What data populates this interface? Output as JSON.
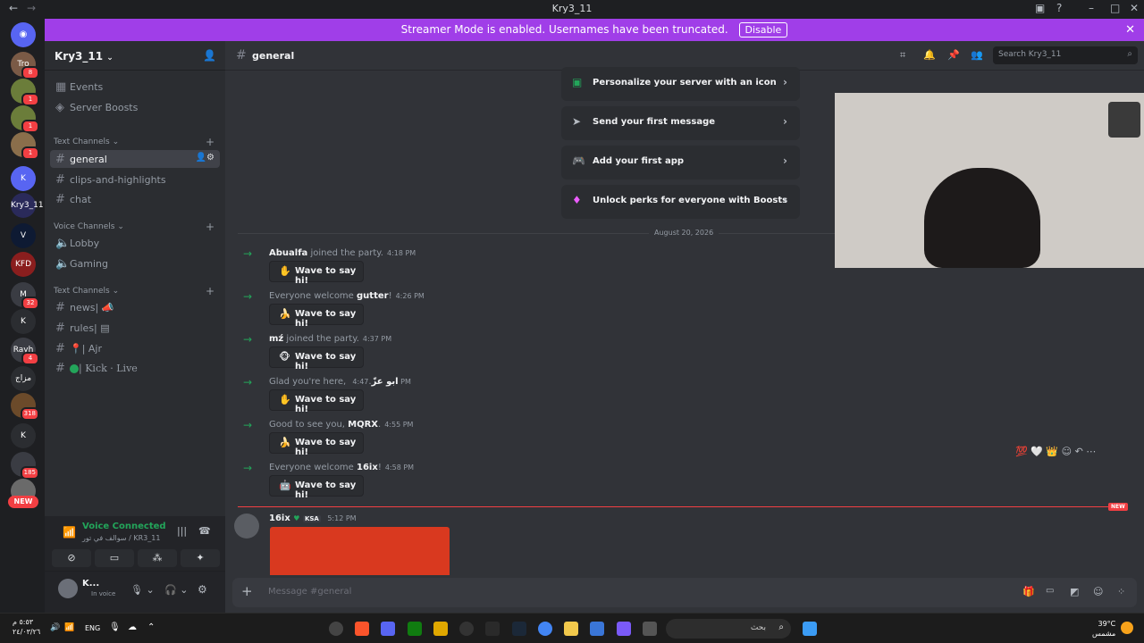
{
  "titlebar": {
    "title": "Kry3_11"
  },
  "banner": {
    "text": "Streamer Mode is enabled. Usernames have been truncated.",
    "button": "Disable",
    "color": "#a03ee8"
  },
  "rail": {
    "items": [
      {
        "label": "Tro",
        "badge": "8"
      },
      {
        "label": "",
        "badge": "1"
      },
      {
        "label": "",
        "badge": "1"
      },
      {
        "label": "",
        "badge": "1"
      },
      {
        "label": "K",
        "badge": ""
      },
      {
        "label": "Kry3_11",
        "badge": ""
      },
      {
        "label": "V",
        "badge": ""
      },
      {
        "label": "KFD",
        "badge": ""
      },
      {
        "label": "M",
        "badge": "32"
      },
      {
        "label": "K",
        "badge": ""
      },
      {
        "label": "Rayh",
        "badge": "4"
      },
      {
        "label": "مزاج",
        "badge": ""
      },
      {
        "label": "",
        "badge": "318"
      },
      {
        "label": "K",
        "badge": ""
      },
      {
        "label": "",
        "badge": "185"
      },
      {
        "label": "",
        "badge": ""
      }
    ],
    "new_label": "NEW"
  },
  "sidebar": {
    "server_name": "Kry3_11",
    "top_items": [
      "Events",
      "Server Boosts"
    ],
    "cat1": "Text Channels",
    "channels1": [
      "general",
      "clips-and-highlights",
      "chat"
    ],
    "cat2": "Voice Channels",
    "voice_channels": [
      "Lobby",
      "Gaming"
    ],
    "cat3": "Text Channels",
    "channels3": [
      "news|",
      "rules|",
      "| Ajr",
      "| Kick · Live"
    ]
  },
  "voice": {
    "status": "Voice Connected",
    "channel": "سوالف في تور / KR3_11"
  },
  "user": {
    "name": "K...",
    "status": "In voice"
  },
  "header": {
    "channel": "general",
    "search_placeholder": "Search Kry3_11"
  },
  "setup_items": [
    "Personalize your server with an icon",
    "Send your first message",
    "Add your first app",
    "Unlock perks for everyone with Boosts"
  ],
  "divider_date": "August 20, 2026",
  "messages": [
    {
      "pre": "",
      "name": "Abualfa",
      "post": " joined the party.",
      "time": "4:18 PM",
      "wave": "Wave to say hi!"
    },
    {
      "pre": "Everyone welcome ",
      "name": "gutter",
      "post": "!",
      "time": "4:26 PM",
      "wave": "Wave to say hi!"
    },
    {
      "pre": "",
      "name": "mź",
      "post": " joined the party.",
      "time": "4:37 PM",
      "wave": "Wave to say hi!"
    },
    {
      "pre": "Glad you're here, ",
      "name": "ابو عزّ",
      "post": ".",
      "time": "4:47 PM",
      "wave": "Wave to say hi!"
    },
    {
      "pre": "Good to see you, ",
      "name": "MQRX",
      "post": ".",
      "time": "4:55 PM",
      "wave": "Wave to say hi!"
    },
    {
      "pre": "Everyone welcome ",
      "name": "16ix",
      "post": "!",
      "time": "4:58 PM",
      "wave": "Wave to say hi!"
    }
  ],
  "last_message": {
    "name": "16ix",
    "tag": "KSA",
    "time": "5:12 PM"
  },
  "new_badge": "NEW",
  "composer": {
    "placeholder": "Message #general"
  },
  "taskbar": {
    "left_time": "٥:٥٣ م",
    "left_date": "٢٤/٠٣/٢٦",
    "lang": "ENG",
    "search": "بحث",
    "weather_temp": "39°C",
    "weather_desc": "مشمس"
  }
}
